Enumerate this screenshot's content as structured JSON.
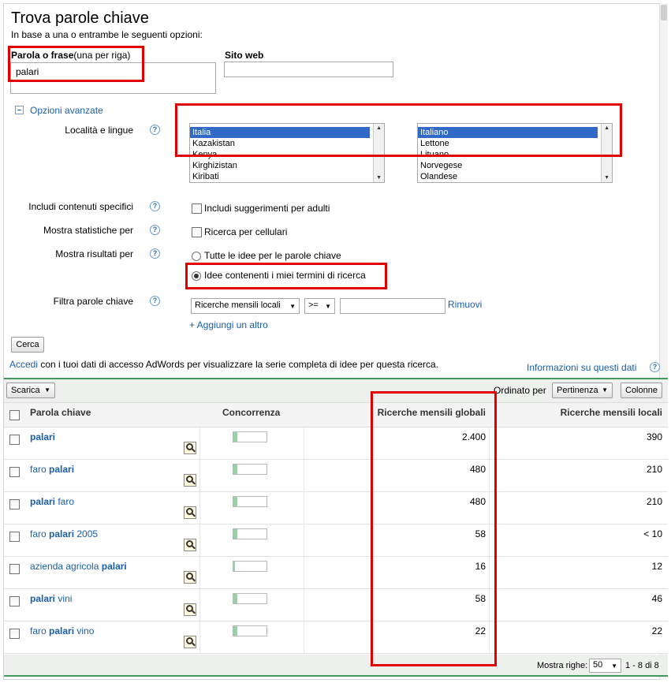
{
  "header": {
    "title": "Trova parole chiave",
    "subtitle": "In base a una o entrambe le seguenti opzioni:"
  },
  "keyword_field": {
    "label_bold": "Parola o frase",
    "label_note": "(una per riga)",
    "value": "palari"
  },
  "website_field": {
    "label": "Sito web",
    "value": ""
  },
  "advanced": {
    "toggle_label": "Opzioni avanzate",
    "localita_label": "Località e lingue",
    "countries": [
      "Italia",
      "Kazakistan",
      "Kenya",
      "Kirghizistan",
      "Kiribati"
    ],
    "languages": [
      "Italiano",
      "Lettone",
      "Lituano",
      "Norvegese",
      "Olandese"
    ],
    "includi_label": "Includi contenuti specifici",
    "includi_option": "Includi suggerimenti per adulti",
    "statistiche_label": "Mostra statistiche per",
    "statistiche_option": "Ricerca per cellulari",
    "risultati_label": "Mostra risultati per",
    "risultati_option_1": "Tutte le idee per le parole chiave",
    "risultati_option_2": "Idee contenenti i miei termini di ricerca",
    "filtra_label": "Filtra parole chiave",
    "filtra_field": "Ricerche mensili locali",
    "filtra_operator": ">=",
    "filtra_value": "",
    "remove_link": "Rimuovi",
    "add_link": "+ Aggiungi un altro"
  },
  "search_button": "Cerca",
  "signin": {
    "link": "Accedi",
    "text": " con i tuoi dati di accesso AdWords per visualizzare la serie completa di idee per questa ricerca.",
    "info_link": "Informazioni su questi dati"
  },
  "toolbar": {
    "download": "Scarica",
    "sorted_by": "Ordinato per",
    "sort_value": "Pertinenza",
    "columns_button": "Colonne"
  },
  "table": {
    "headers": {
      "keyword": "Parola chiave",
      "competition": "Concorrenza",
      "global": "Ricerche mensili globali",
      "local": "Ricerche mensili locali"
    },
    "rows": [
      {
        "pre": "",
        "bold": "palari",
        "post": "",
        "competition": 0.12,
        "global": "2.400",
        "local": "390"
      },
      {
        "pre": "faro ",
        "bold": "palari",
        "post": "",
        "competition": 0.12,
        "global": "480",
        "local": "210"
      },
      {
        "pre": "",
        "bold": "palari",
        "post": " faro",
        "competition": 0.12,
        "global": "480",
        "local": "210"
      },
      {
        "pre": "faro ",
        "bold": "palari",
        "post": " 2005",
        "competition": 0.12,
        "global": "58",
        "local": "< 10"
      },
      {
        "pre": "azienda agricola ",
        "bold": "palari",
        "post": "",
        "competition": 0.05,
        "global": "16",
        "local": "12"
      },
      {
        "pre": "",
        "bold": "palari",
        "post": " vini",
        "competition": 0.12,
        "global": "58",
        "local": "46"
      },
      {
        "pre": "faro ",
        "bold": "palari",
        "post": " vino",
        "competition": 0.12,
        "global": "22",
        "local": "22"
      }
    ]
  },
  "footer": {
    "rows_label": "Mostra righe:",
    "rows_value": "50",
    "range": "1 - 8 di 8"
  },
  "colors": {
    "link": "#1a5ea8",
    "highlight": "#e00000",
    "accent_green": "#3f9a5f",
    "selected": "#3169c6"
  }
}
